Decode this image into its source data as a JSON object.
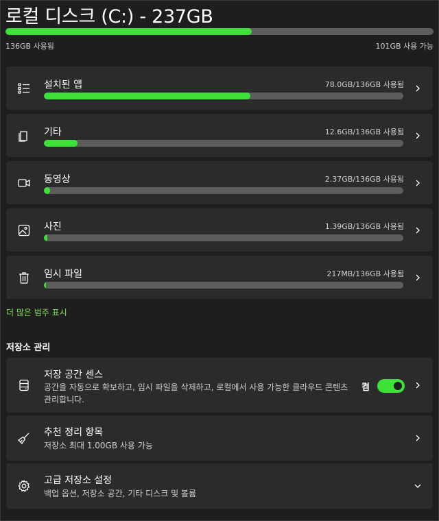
{
  "header": {
    "title": "로컬 디스크 (C:) - 237GB",
    "used_label": "136GB 사용됨",
    "free_label": "101GB 사용 가능",
    "used_fraction": 0.575
  },
  "categories": [
    {
      "icon": "apps-list-icon",
      "name": "설치된 앱",
      "amount": "78.0GB/136GB 사용됨",
      "fraction": 0.574
    },
    {
      "icon": "other-files-icon",
      "name": "기타",
      "amount": "12.6GB/136GB 사용됨",
      "fraction": 0.093
    },
    {
      "icon": "video-icon",
      "name": "동영상",
      "amount": "2.37GB/136GB 사용됨",
      "fraction": 0.017
    },
    {
      "icon": "image-icon",
      "name": "사진",
      "amount": "1.39GB/136GB 사용됨",
      "fraction": 0.01
    },
    {
      "icon": "trash-icon",
      "name": "임시 파일",
      "amount": "217MB/136GB 사용됨",
      "fraction": 0.0016
    }
  ],
  "more_categories_link": "더 많은 범주 표시",
  "management": {
    "title": "저장소 관리",
    "storage_sense": {
      "name": "저장 공간 센스",
      "desc": "공간을 자동으로 확보하고, 임시 파일을 삭제하고, 로컬에서 사용 가능한 클라우드 콘텐츠 관리합니다.",
      "toggle_label": "켬",
      "toggle_on": true
    },
    "cleanup": {
      "name": "추천 정리 항목",
      "desc": "저장소 최대 1.00GB 사용 가능"
    },
    "advanced": {
      "name": "고급 저장소 설정",
      "desc": "백업 옵션, 저장소 공간, 기타 디스크 및 볼륨"
    }
  },
  "colors": {
    "accent": "#3fe03a",
    "bar_track": "#5d5d5d",
    "card": "#2b2b2b",
    "background": "#1e1e1e",
    "link": "#7fd95a"
  }
}
